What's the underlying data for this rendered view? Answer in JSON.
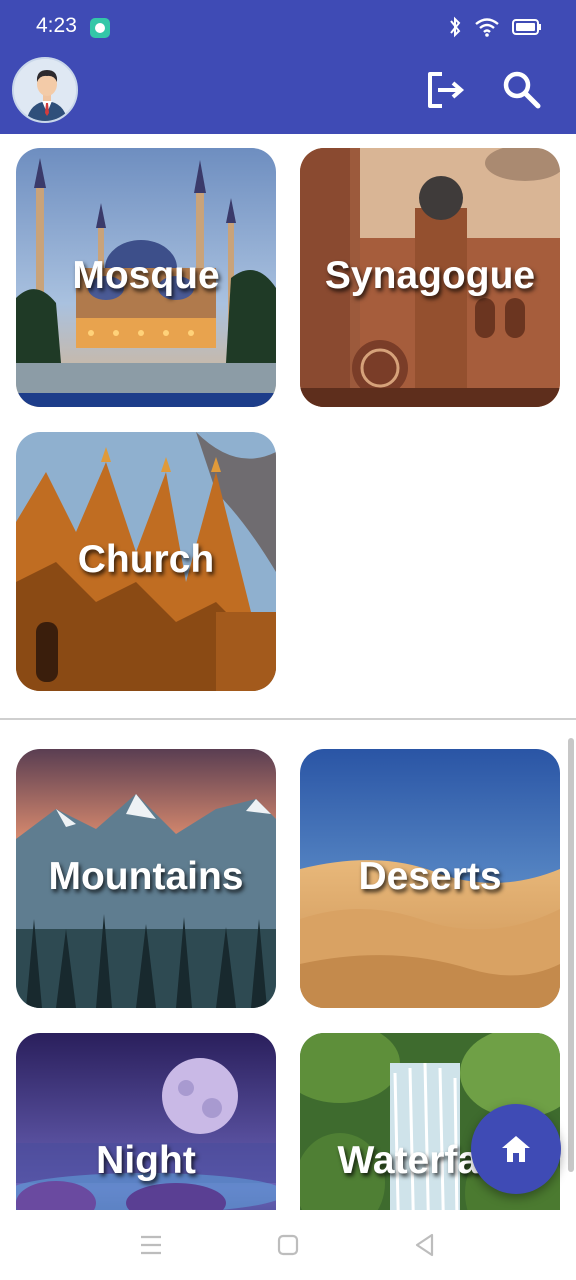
{
  "status_bar": {
    "time": "4:23",
    "icons": [
      "app-notification-icon",
      "bluetooth-icon",
      "wifi-icon",
      "battery-icon"
    ]
  },
  "app_bar": {
    "background": "#3f4bb5",
    "actions": [
      "logout-icon",
      "search-icon"
    ]
  },
  "sections": [
    {
      "tiles": [
        {
          "label": "Mosque"
        },
        {
          "label": "Synagogue"
        },
        {
          "label": "Church"
        }
      ]
    },
    {
      "tiles": [
        {
          "label": "Mountains"
        },
        {
          "label": "Deserts"
        },
        {
          "label": "Night"
        },
        {
          "label": "Waterfalls"
        }
      ]
    }
  ],
  "fab": {
    "icon": "home-icon",
    "color": "#3f4bb5"
  },
  "system_nav": {
    "buttons": [
      "menu-icon",
      "home-square-icon",
      "back-triangle-icon"
    ]
  }
}
